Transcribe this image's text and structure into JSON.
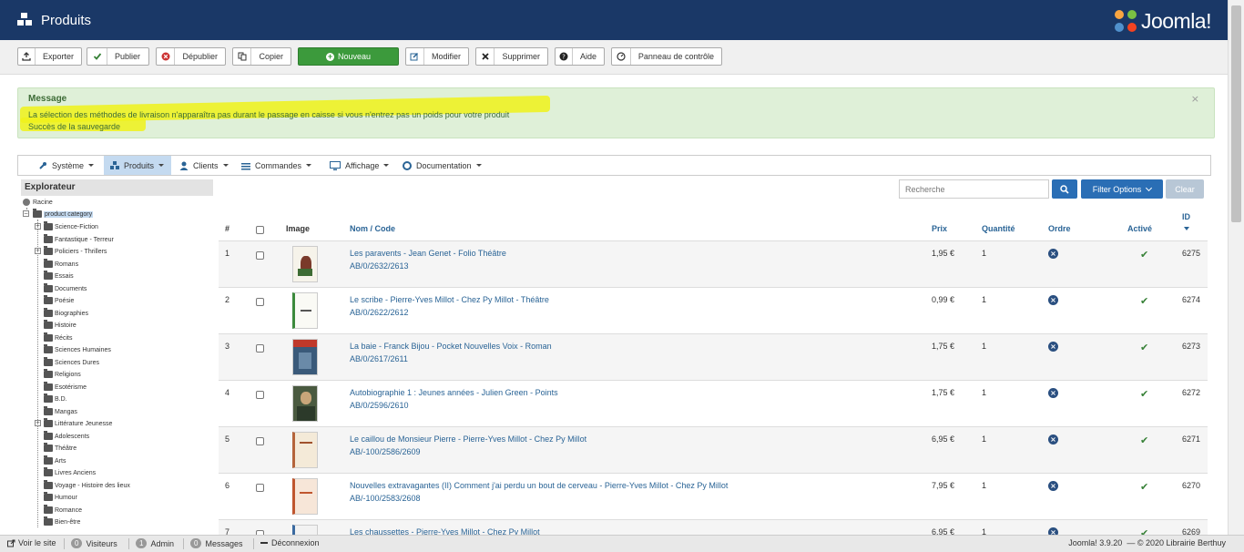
{
  "header": {
    "title": "Produits",
    "logo_text": "Joomla!"
  },
  "toolbar": {
    "buttons": [
      {
        "label": "Exporter"
      },
      {
        "label": "Publier"
      },
      {
        "label": "Dépublier"
      },
      {
        "label": "Copier"
      },
      {
        "label": "Nouveau"
      },
      {
        "label": "Modifier"
      },
      {
        "label": "Supprimer"
      },
      {
        "label": "Aide"
      },
      {
        "label": "Panneau de contrôle"
      }
    ]
  },
  "message": {
    "title": "Message",
    "line1": "La sélection des méthodes de livraison n'apparaîtra pas durant le passage en caisse si vous n'entrez pas un poids pour votre produit",
    "line2": "Succès de la sauvegarde",
    "close": "×",
    "highlight_color": "#f0f21a"
  },
  "menu": {
    "items": [
      {
        "label": "Système"
      },
      {
        "label": "Produits"
      },
      {
        "label": "Clients"
      },
      {
        "label": "Commandes"
      },
      {
        "label": "Affichage"
      },
      {
        "label": "Documentation"
      }
    ]
  },
  "explorer": {
    "title": "Explorateur",
    "root": "Racine",
    "category": "product category",
    "children": [
      "Science-Fiction",
      "Fantastique - Terreur",
      "Policiers - Thrillers",
      "Romans",
      "Essais",
      "Documents",
      "Poésie",
      "Biographies",
      "Histoire",
      "Récits",
      "Sciences Humaines",
      "Sciences Dures",
      "Religions",
      "Esotérisme",
      "B.D.",
      "Mangas",
      "Littérature Jeunesse",
      "Adolescents",
      "Théâtre",
      "Arts",
      "Livres Anciens",
      "Voyage - Histoire des lieux",
      "Humour",
      "Romance",
      "Bien-être"
    ]
  },
  "search": {
    "placeholder": "Recherche",
    "filter_label": "Filter Options",
    "clear_label": "Clear"
  },
  "table": {
    "headers": {
      "num": "#",
      "image": "Image",
      "name": "Nom / Code",
      "price": "Prix",
      "qty": "Quantité",
      "order": "Ordre",
      "active": "Activé",
      "id": "ID"
    },
    "rows": [
      {
        "num": "1",
        "name": "Les paravents - Jean Genet - Folio Théâtre",
        "code": "AB/0/2632/2613",
        "price": "1,95 €",
        "qty": "1",
        "id": "6275"
      },
      {
        "num": "2",
        "name": "Le scribe - Pierre-Yves Millot - Chez Py Millot - Théâtre",
        "code": "AB/0/2622/2612",
        "price": "0,99 €",
        "qty": "1",
        "id": "6274"
      },
      {
        "num": "3",
        "name": "La baie - Franck Bijou - Pocket Nouvelles Voix - Roman",
        "code": "AB/0/2617/2611",
        "price": "1,75 €",
        "qty": "1",
        "id": "6273"
      },
      {
        "num": "4",
        "name": "Autobiographie 1 : Jeunes années - Julien Green - Points",
        "code": "AB/0/2596/2610",
        "price": "1,75 €",
        "qty": "1",
        "id": "6272"
      },
      {
        "num": "5",
        "name": "Le caillou de Monsieur Pierre - Pierre-Yves Millot - Chez Py Millot",
        "code": "AB/-100/2586/2609",
        "price": "6,95 €",
        "qty": "1",
        "id": "6271"
      },
      {
        "num": "6",
        "name": "Nouvelles extravagantes (II) Comment j'ai perdu un bout de cerveau - Pierre-Yves Millot - Chez Py Millot",
        "code": "AB/-100/2583/2608",
        "price": "7,95 €",
        "qty": "1",
        "id": "6270"
      },
      {
        "num": "7",
        "name": "Les chaussettes - Pierre-Yves Millot - Chez Py Millot",
        "code": "",
        "price": "6,95 €",
        "qty": "1",
        "id": "6269"
      }
    ]
  },
  "footer": {
    "view_site": "Voir le site",
    "visitors_count": "0",
    "visitors": "Visiteurs",
    "admin_count": "1",
    "admin": "Admin",
    "messages_count": "0",
    "messages": "Messages",
    "logout": "Déconnexion",
    "version": "Joomla! 3.9.20",
    "copyright": "— © 2020 Librairie Berthuy"
  },
  "colors": {
    "header_bg": "#1a3867",
    "accent_blue": "#2a6496",
    "success_green": "#3c9a3c",
    "message_bg": "#dff0d8"
  }
}
